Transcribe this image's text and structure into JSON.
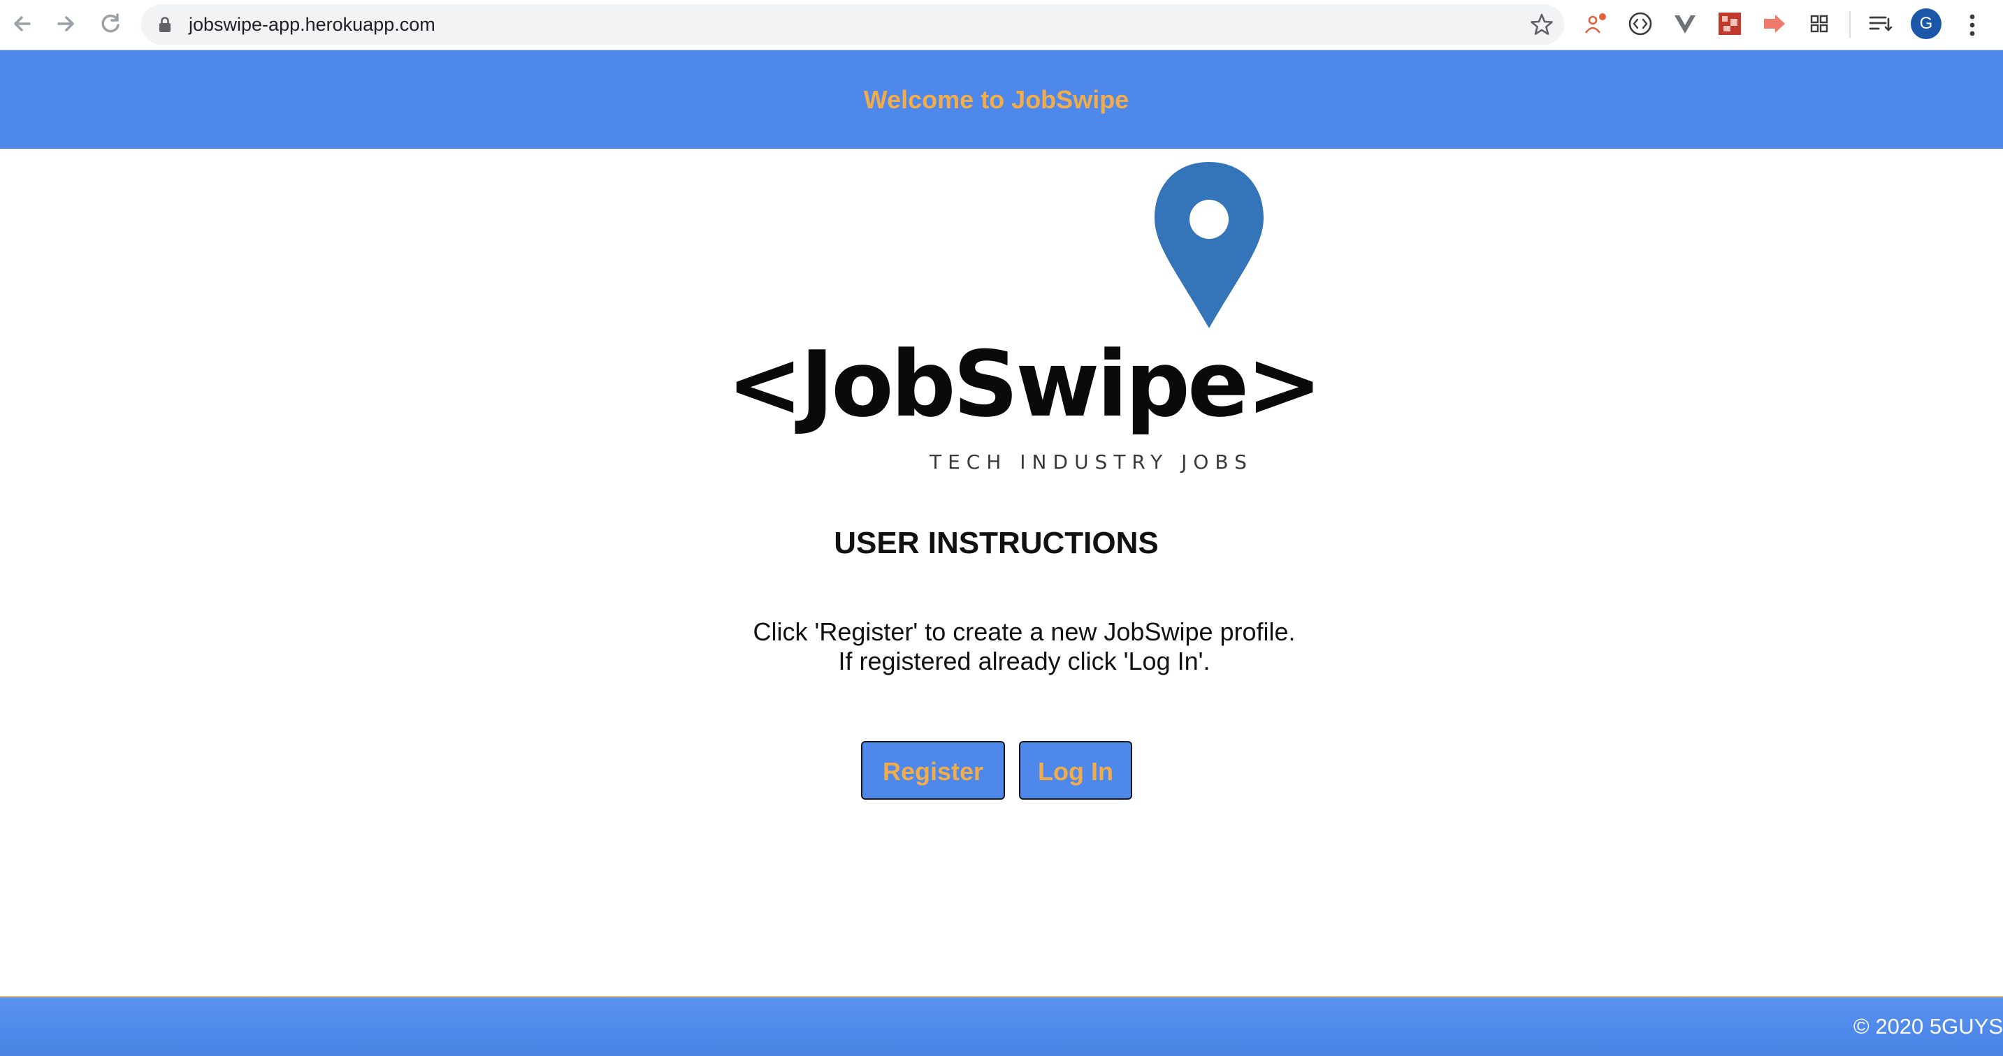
{
  "browser": {
    "url": "jobswipe-app.herokuapp.com",
    "profile_initial": "G",
    "extension_icons": [
      "extension-people-icon",
      "extension-code-icon",
      "extension-vue-icon",
      "extension-pixel-icon",
      "extension-arrow-icon",
      "extension-grid-icon",
      "reading-list-icon"
    ]
  },
  "header": {
    "welcome_text": "Welcome to JobSwipe"
  },
  "logo": {
    "wordmark": "<JobSwipe>",
    "tagline": "TECH INDUSTRY JOBS"
  },
  "instructions": {
    "title": "USER INSTRUCTIONS",
    "line1": "Click 'Register' to create a new JobSwipe profile.",
    "line2": "If registered already click 'Log In'."
  },
  "actions": {
    "register_label": "Register",
    "login_label": "Log In"
  },
  "footer": {
    "copyright": "© 2020 5GUYS"
  },
  "colors": {
    "brand_blue": "#4e88ea",
    "accent_orange": "#f2ad4a",
    "pin_blue": "#3474b8"
  }
}
